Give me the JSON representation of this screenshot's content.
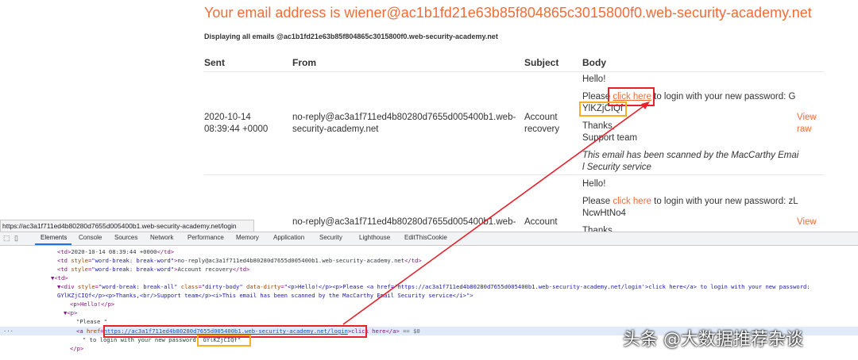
{
  "page": {
    "title": "Your email address is wiener@ac1b1fd21e63b85f804865c3015800f0.web-security-academy.net",
    "subtitle": "Displaying all emails @ac1b1fd21e63b85f804865c3015800f0.web-security-academy.net",
    "table_headers": {
      "sent": "Sent",
      "from": "From",
      "subject": "Subject",
      "body": "Body"
    },
    "emails": [
      {
        "sent_date": "2020-10-14",
        "sent_time": "08:39:44 +0000",
        "from_line1": "no-reply@ac3a1f711ed4b80280d7655d005400b1.web-",
        "from_line2": "security-academy.net",
        "subject_line1": "Account",
        "subject_line2": "recovery",
        "body_hello": "Hello!",
        "body_please": "Please ",
        "body_link": "click here",
        "body_rest": " to login with your new password: G",
        "body_password_end": "YlKZjCIQf",
        "body_thanks": "Thanks,",
        "body_team": "Support team",
        "body_scan_line1": "This email has been scanned by the MacCarthy Emai",
        "body_scan_line2": "l Security service",
        "view_raw_line1": "View",
        "view_raw_line2": "raw"
      },
      {
        "from_line1": "no-reply@ac3a1f711ed4b80280d7655d005400b1.web-",
        "subject_line1": "Account",
        "body_hello": "Hello!",
        "body_please": "Please ",
        "body_link": "click here",
        "body_rest": " to login with your new password: zL",
        "body_password_end": "NcwHtNo4",
        "body_thanks": "Thanks",
        "view_raw_line1": "View"
      }
    ]
  },
  "status_url": "https://ac3a1f711ed4b80280d7655d005400b1.web-security-academy.net/login",
  "devtools": {
    "tabs": [
      "Elements",
      "Console",
      "Sources",
      "Network",
      "Performance",
      "Memory",
      "Application",
      "Security",
      "Lighthouse",
      "EditThisCookie"
    ],
    "lines": {
      "l1_open": "<td>",
      "l1_text": "2020-10-14 08:39:44 +0000",
      "l1_close": "</td>",
      "l2_open": "<td ",
      "l2_attr": "style",
      "l2_val": "\"word-break: break-word\"",
      "l2_gt": ">",
      "l2_text": "no-reply@ac3a1f711ed4b80280d7655d005400b1.web-security-academy.net",
      "l2_close": "</td>",
      "l3_text": "Account recovery",
      "l4": "▼<td>",
      "l5_open": "▼<div ",
      "l5_attr1": "style",
      "l5_val1": "\"word-break: break-all\"",
      "l5_attr2": "class",
      "l5_val2": "\"dirty-body\"",
      "l5_attr3": "data-dirty",
      "l5_val3": "\"<p>Hello!</p><p>Please <a href='https://ac3a1f711ed4b80280d7655d005400b1.web-security-academy.net/login'>click here</a> to login with your new password:",
      "l6_val": "GYlKZjCIQf</p><p>Thanks,<br/>Support team</p><i>This email has been scanned by the MacCarthy Email Security service</i>\">",
      "l7": "<p>Hello!</p>",
      "l8": "▼<p>",
      "l9": "\"Please \"",
      "l10_open": "<a ",
      "l10_attr": "href",
      "l10_eq": "=",
      "l10_link": "https://ac3a1f711ed4b80280d7655d005400b1.web-security-academy.net/login",
      "l10_text": ">click here</a>",
      "l10_eq0": " == $0",
      "l11_text": "\" to login with your new password: ",
      "l11_pw": "GYlKZjCIQf\"",
      "l12": "</p>"
    }
  },
  "watermark": "头条 @大数据推荐杂谈",
  "colors": {
    "accent": "#f16d38",
    "red_box": "#e8202a",
    "yellow_box": "#f5b020",
    "arrow": "#e8202a"
  }
}
